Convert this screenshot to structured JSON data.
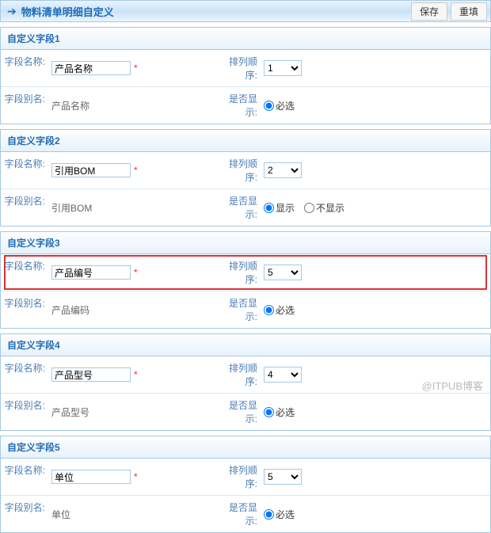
{
  "header": {
    "title": "物料清单明细自定义",
    "save": "保存",
    "refill": "重填"
  },
  "labels": {
    "name": "字段名称:",
    "alias": "字段别名:",
    "order": "排列顺序:",
    "show": "是否显示:"
  },
  "required": "必选",
  "radio": {
    "show": "显示",
    "hide": "不显示"
  },
  "sections": [
    {
      "title": "自定义字段1",
      "name": "产品名称",
      "alias": "产品名称",
      "order": "1",
      "showType": "required",
      "highlight": false
    },
    {
      "title": "自定义字段2",
      "name": "引用BOM",
      "alias": "引用BOM",
      "order": "2",
      "showType": "radio",
      "highlight": false
    },
    {
      "title": "自定义字段3",
      "name": "产品编号",
      "alias": "产品编码",
      "order": "5",
      "showType": "required",
      "highlight": true
    },
    {
      "title": "自定义字段4",
      "name": "产品型号",
      "alias": "产品型号",
      "order": "4",
      "showType": "required",
      "highlight": false
    },
    {
      "title": "自定义字段5",
      "name": "单位",
      "alias": "单位",
      "order": "5",
      "showType": "required",
      "highlight": false
    }
  ],
  "watermark": "@ITPUB博客"
}
